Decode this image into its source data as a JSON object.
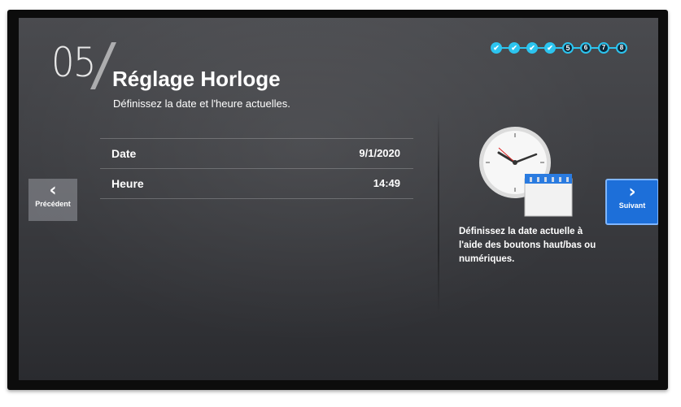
{
  "step": {
    "number": "05"
  },
  "header": {
    "title": "Réglage Horloge",
    "subtitle": "Définissez la date et l'heure actuelles."
  },
  "fields": [
    {
      "label": "Date",
      "value": "9/1/2020"
    },
    {
      "label": "Heure",
      "value": "14:49"
    }
  ],
  "progress": {
    "total_steps": 8,
    "current_step": 5,
    "steps": [
      "✔",
      "✔",
      "✔",
      "✔",
      "5",
      "6",
      "7",
      "8"
    ]
  },
  "nav": {
    "previous_label": "Précédent",
    "next_label": "Suivant"
  },
  "help_text": "Définissez la date actuelle à l'aide des boutons haut/bas ou numériques.",
  "colors": {
    "accent": "#1d6fd9",
    "progress": "#2cc4ef",
    "background": "#3e3f43"
  },
  "icons": [
    "clock-icon",
    "calendar-icon",
    "chevron-left-icon",
    "chevron-right-icon",
    "checkmark-icon"
  ]
}
